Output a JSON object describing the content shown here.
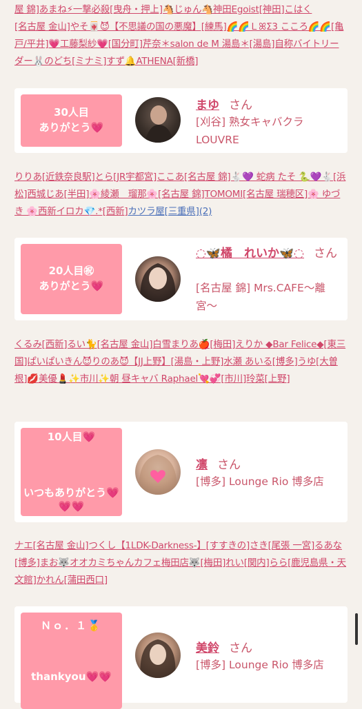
{
  "names_block_1": [
    {
      "text": "屋 錦]あまね⚡一撃必殺[曳舟・押上]🐴じゅん🐴神田Egoist[神田]こはく"
    },
    {
      "text": "[名古屋 金山]やそ🀄😈【不思議の国の悪魔】[練馬]🌈🌈ＬꕤΣ3 こころ🌈🌈[亀戸/平井]💗工藤梨紗💗[国分町]芹奈＊salon de M 湯島＊[湯島]自称バイトリーダー🐰のどち[ミナミ]すず🔔ATHENA[新橋]"
    }
  ],
  "cards": [
    {
      "rank": "30人目",
      "thanks": "ありがとう💗",
      "name": "まゆ",
      "honorific": "さん",
      "shop": "[刈谷] 熟女キャバクラ LOUVRE"
    },
    {
      "rank": "20人目㊗",
      "thanks": "ありがとう💗",
      "name": "◌🦋橘　れいか🦋◌",
      "honorific": "さん",
      "shop": "[名古屋 錦] Mrs.CAFE〜離宮〜"
    },
    {
      "rank": "10人目💗",
      "thanks": "いつもありがとう💗💗💗",
      "name": "凛",
      "honorific": "さん",
      "shop": "[博多] Lounge Rio 博多店"
    },
    {
      "rank": "Ｎｏ．１🥇",
      "thanks": "thankyou💗💗",
      "name": "美鈴",
      "honorific": "さん",
      "shop": "[博多] Lounge Rio 博多店"
    }
  ],
  "names_block_2": "りりあ[近鉄奈良駅]とら[JR宇都宮]ここあ[名古屋 錦]🐇💜 蛇病 たそ 🐍💜🐇[浜松]西城じあ[半田]🌸綾瀬　瑠那🌸[名古屋 錦]TOMOMI[名古屋 瑞穂区]🌸 ゆづき 🌸西新イロカ💎.*[西新]",
  "names_block_2_link": "カツラ屋[三重県](2)",
  "names_block_3": "くるみ[西新]るい🐈[名古屋 金山]白雪まりあ🍎[梅田]えりか ◆Bar Felice◆[東三国]ぱいぱいきん😈りのあ😈【JJ上野】[湯島・上野]水瀬 あいる[博多]うゆ[大曽根]💋美優💄✨市川✨朝 昼キャバ Raphael💘💞[市川]玲菜[上野]",
  "names_block_4": "ナエ[名古屋 金山]つくし【1LDK-Darkness-】[すすきの]さき[尾張 一宮]るあな[博多]まお🐺オオカミちゃんカフェ梅田店🐺[梅田]れい[関内]らら[鹿児島県・天文館]かれん[蒲田西口]",
  "colors": {
    "accent": "#d0476a",
    "ribbon": "#ff9aa9",
    "link_blue": "#4a6fb8",
    "background": "#f5f1ec"
  }
}
